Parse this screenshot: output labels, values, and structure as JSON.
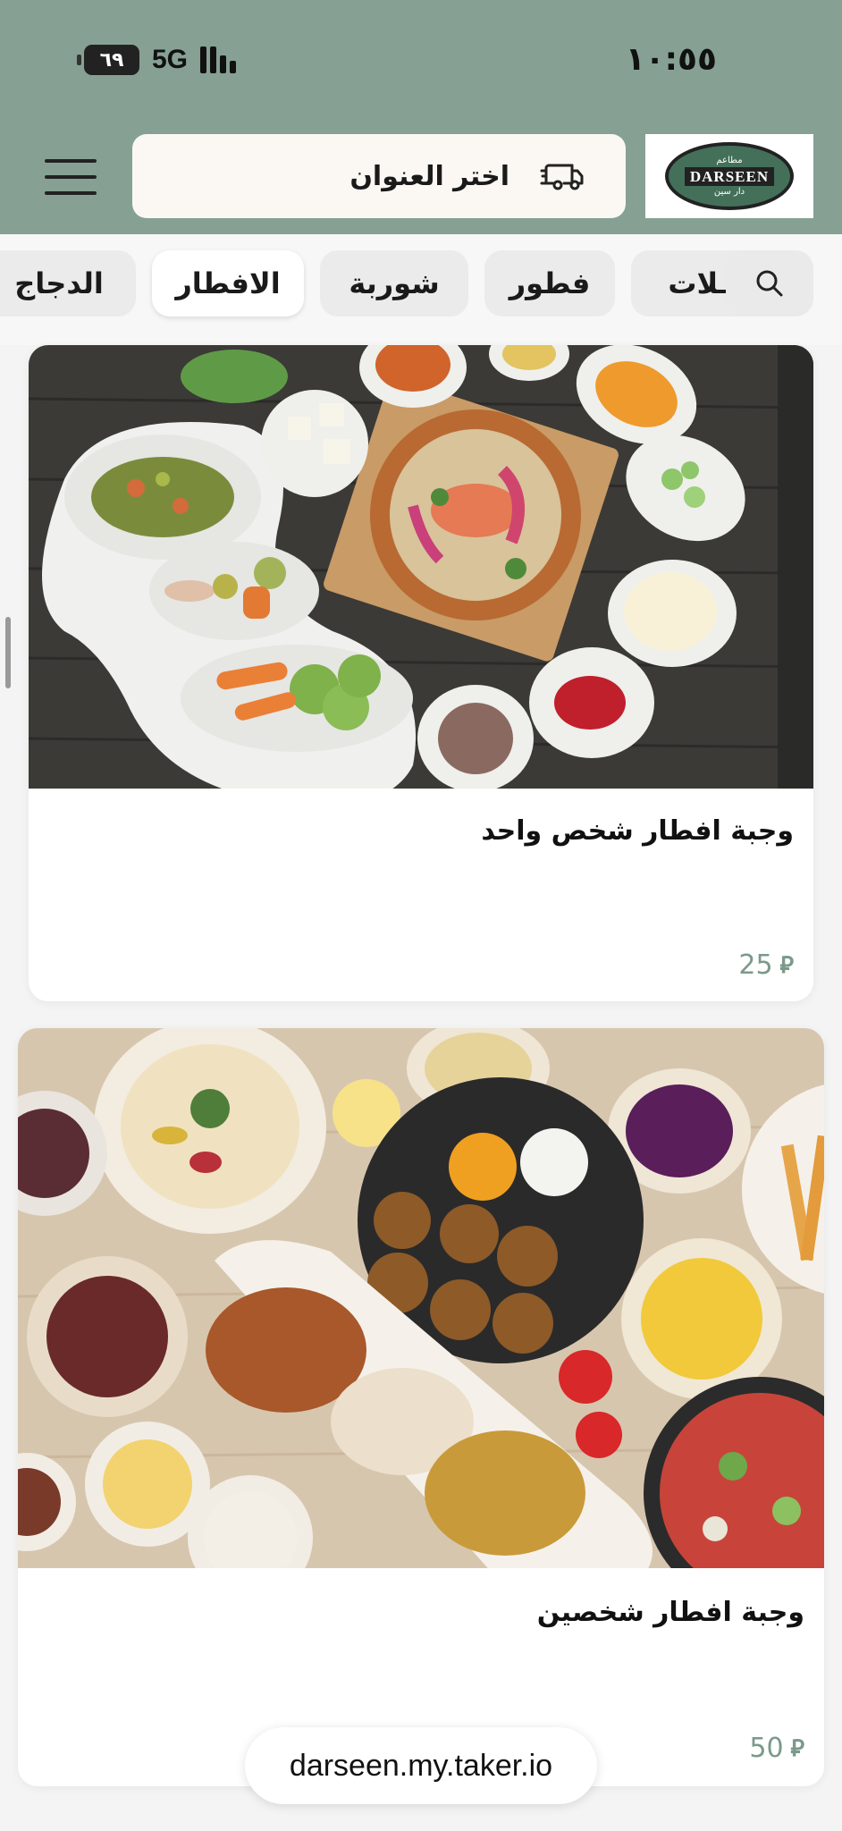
{
  "status_bar": {
    "time": "١٠:٥٥",
    "battery": "٦٩",
    "network": "5G"
  },
  "header": {
    "address_label": "اختر العنوان",
    "logo": {
      "name": "DARSEEN",
      "arabic_top": "مطاعم",
      "arabic_bottom": "دار سين"
    }
  },
  "categories": [
    {
      "label": "ـلات",
      "active": false
    },
    {
      "label": "فطور",
      "active": false
    },
    {
      "label": "شوربة",
      "active": false
    },
    {
      "label": "الافطار",
      "active": true
    },
    {
      "label": "الدجاج",
      "active": false
    }
  ],
  "products": [
    {
      "title": "وجبة افطار شخص واحد",
      "price": "25",
      "currency_symbol": "⃁"
    },
    {
      "title": "وجبة افطار شخصين",
      "price": "50",
      "currency_symbol": "⃁"
    }
  ],
  "browser": {
    "url": "darseen.my.taker.io"
  },
  "colors": {
    "header_bg": "#86a193",
    "price": "#7a9a8b",
    "logo_green": "#44705a"
  },
  "icons": [
    "menu-icon",
    "truck-icon",
    "search-icon",
    "battery-icon",
    "signal-icon"
  ]
}
